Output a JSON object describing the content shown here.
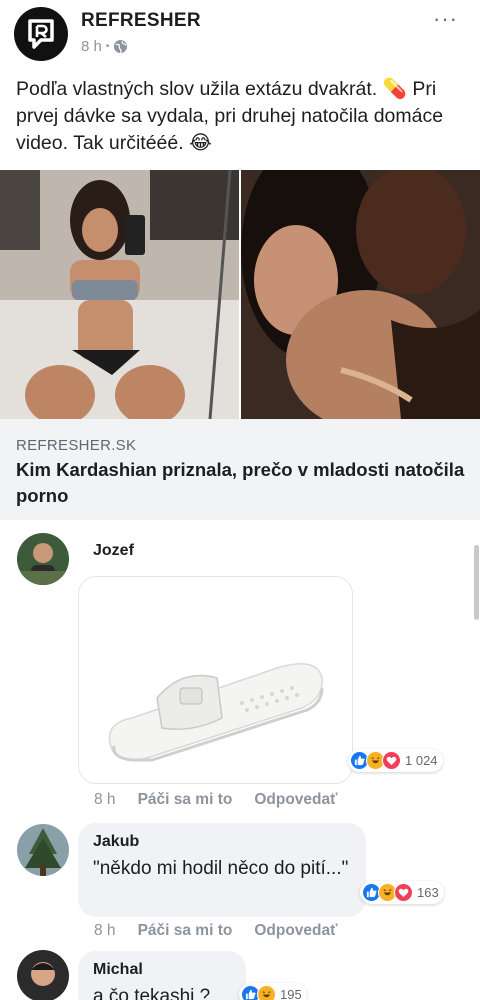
{
  "post": {
    "page_name": "REFRESHER",
    "time": "8 h",
    "separator": "•",
    "privacy_icon": "globe-icon",
    "more_label": "···",
    "text": "Podľa vlastných slov užila extázu dvakrát. 💊 Pri prvej dávke sa vydala, pri druhej natočila domáce video. Tak určitééé. 😂"
  },
  "link": {
    "domain": "REFRESHER.SK",
    "title": "Kim Kardashian priznala, prečo v mladosti natočila porno"
  },
  "comments": [
    {
      "name": "Jozef",
      "time": "8 h",
      "like_label": "Páči sa mi to",
      "reply_label": "Odpovedať",
      "reaction_count": "1 024",
      "reactions": [
        "like-icon",
        "haha-icon",
        "love-icon"
      ]
    },
    {
      "name": "Jakub",
      "text": "\"někdo mi hodil něco do pití...\"",
      "time": "8 h",
      "like_label": "Páči sa mi to",
      "reply_label": "Odpovedať",
      "reaction_count": "163",
      "reactions": [
        "like-icon",
        "haha-icon",
        "love-icon"
      ]
    },
    {
      "name": "Michal",
      "text": "a čo tekashi ?",
      "reaction_count": "195",
      "reactions": [
        "like-icon",
        "haha-icon"
      ]
    }
  ],
  "colors": {
    "accent": "#1877f2",
    "haha": "#f7b125",
    "love": "#f33e58",
    "muted": "#8d949e"
  }
}
